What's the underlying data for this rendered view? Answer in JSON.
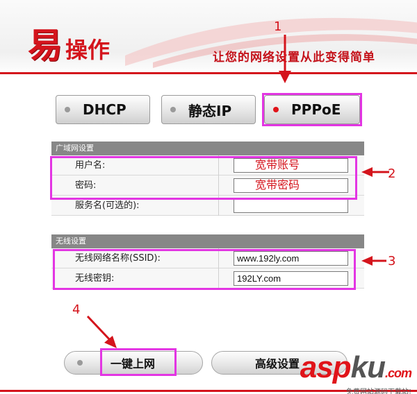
{
  "header": {
    "logo_big": "易",
    "logo_small": "操作",
    "slogan": "让您的网络设置从此变得简单"
  },
  "modes": [
    {
      "label": "DHCP",
      "active": false
    },
    {
      "label": "静态IP",
      "active": false
    },
    {
      "label": "PPPoE",
      "active": true
    }
  ],
  "wan": {
    "title": "广域网设置",
    "fields": [
      {
        "label": "用户名:",
        "value": "宽带账号"
      },
      {
        "label": "密码:",
        "value": "宽带密码"
      },
      {
        "label": "服务名(可选的):",
        "value": ""
      }
    ]
  },
  "wireless": {
    "title": "无线设置",
    "fields": [
      {
        "label": "无线网络名称(SSID):",
        "value": "www.192ly.com"
      },
      {
        "label": "无线密钥:",
        "value": "192LY.com"
      }
    ]
  },
  "buttons": {
    "one_click": "一键上网",
    "advanced": "高级设置"
  },
  "annotations": {
    "n1": "1",
    "n2": "2",
    "n3": "3",
    "n4": "4"
  },
  "watermark": {
    "main_a": "asp",
    "main_b": "ku",
    "tld": ".com",
    "sub": "免费网站源码下载站!"
  },
  "colors": {
    "accent": "#d4141c",
    "highlight": "#e335e3"
  }
}
